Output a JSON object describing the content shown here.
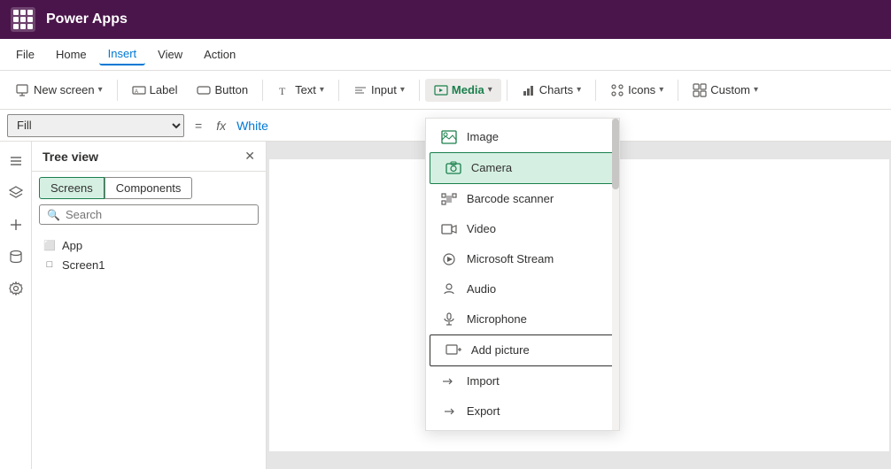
{
  "app": {
    "title": "Power Apps"
  },
  "menu": {
    "items": [
      {
        "id": "file",
        "label": "File"
      },
      {
        "id": "home",
        "label": "Home"
      },
      {
        "id": "insert",
        "label": "Insert",
        "active": true
      },
      {
        "id": "view",
        "label": "View"
      },
      {
        "id": "action",
        "label": "Action"
      }
    ]
  },
  "toolbar": {
    "new_screen_label": "New screen",
    "label_label": "Label",
    "button_label": "Button",
    "text_label": "Text",
    "input_label": "Input",
    "media_label": "Media",
    "charts_label": "Charts",
    "icons_label": "Icons",
    "custom_label": "Custom"
  },
  "formula_bar": {
    "select_value": "Fill",
    "equals": "=",
    "fx": "fx",
    "value": "White"
  },
  "tree_view": {
    "title": "Tree view",
    "tabs": [
      {
        "id": "screens",
        "label": "Screens",
        "active": true
      },
      {
        "id": "components",
        "label": "Components"
      }
    ],
    "search_placeholder": "Search",
    "items": [
      {
        "id": "app",
        "label": "App",
        "icon": "app"
      },
      {
        "id": "screen1",
        "label": "Screen1",
        "icon": "screen"
      }
    ]
  },
  "media_dropdown": {
    "items": [
      {
        "id": "image",
        "label": "Image",
        "icon": "image",
        "highlighted": false
      },
      {
        "id": "camera",
        "label": "Camera",
        "icon": "camera",
        "highlighted": true
      },
      {
        "id": "barcode",
        "label": "Barcode scanner",
        "icon": "barcode"
      },
      {
        "id": "video",
        "label": "Video",
        "icon": "video"
      },
      {
        "id": "ms-stream",
        "label": "Microsoft Stream",
        "icon": "stream"
      },
      {
        "id": "audio",
        "label": "Audio",
        "icon": "audio"
      },
      {
        "id": "microphone",
        "label": "Microphone",
        "icon": "microphone"
      },
      {
        "id": "add-picture",
        "label": "Add picture",
        "icon": "add-picture",
        "outlined": true
      },
      {
        "id": "import",
        "label": "Import",
        "icon": "import"
      },
      {
        "id": "export",
        "label": "Export",
        "icon": "export"
      }
    ]
  },
  "colors": {
    "active_tab": "#d5f0e3",
    "active_border": "#1a7f4c",
    "title_bar": "#4a154b",
    "accent": "#0078d4"
  }
}
